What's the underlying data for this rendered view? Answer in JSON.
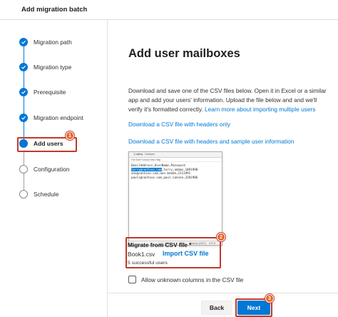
{
  "window": {
    "title": "Add migration batch"
  },
  "colors": {
    "accent": "#0078d4",
    "highlight": "#c0392b",
    "badge": "#e8672c"
  },
  "steps": [
    {
      "label": "Migration path",
      "state": "done"
    },
    {
      "label": "Migration type",
      "state": "done"
    },
    {
      "label": "Prerequisite",
      "state": "done"
    },
    {
      "label": "Migration endpoint",
      "state": "done"
    },
    {
      "label": "Add users",
      "state": "current"
    },
    {
      "label": "Configuration",
      "state": "pending"
    },
    {
      "label": "Schedule",
      "state": "pending"
    }
  ],
  "callouts": {
    "one": "1",
    "two": "2",
    "three": "3"
  },
  "main": {
    "heading": "Add user mailboxes",
    "description": "Download and save one of the CSV files below. Open it in Excel or a similar app and add your users' information. Upload the file below and and we'll verify it's formatted correctly.",
    "learn_more": "Learn more about importing multiple users",
    "download_headers": "Download a CSV file with headers only",
    "download_sample": "Download a CSV file with headers and sample user information"
  },
  "notepad": {
    "title": "*Untitled - Notepad",
    "menu": "File  Edit  Format  View  Help",
    "lines": [
      {
        "selected": "",
        "rest": "EmailAddress,UserName,Password"
      },
      {
        "selected": "terry@contoso.com",
        "rest": ",terry.adams,1091990"
      },
      {
        "selected": "",
        "rest": "ann@contoso.com,ann.beebe,2111991"
      },
      {
        "selected": "",
        "rest": "paulc@contoso.com,paul.cannon,3281986"
      }
    ],
    "status_position": "Ln 1, Col 1",
    "status_zoom": "100%",
    "status_eol": "Windows (CRLF)",
    "status_encoding": "UTF-8"
  },
  "csv": {
    "label": "Migrate from CSV file *",
    "file_name": "Book1.csv",
    "import_label": "Import CSV file",
    "status": "5 successful users"
  },
  "options": {
    "allow_unknown_columns": "Allow unknown columns in the CSV file",
    "allow_unknown_checked": false
  },
  "footer": {
    "back_label": "Back",
    "next_label": "Next"
  }
}
